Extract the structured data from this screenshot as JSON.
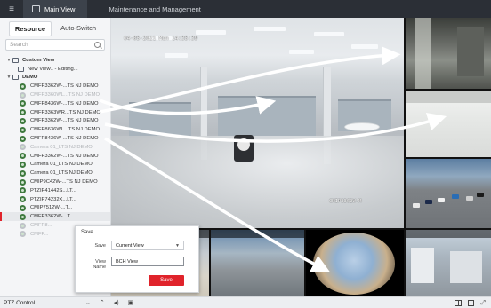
{
  "titlebar": {
    "menu_icon": "menu-icon",
    "tabs": [
      {
        "label": "Main View",
        "active": true
      },
      {
        "label": "Maintenance and Management",
        "active": false
      }
    ]
  },
  "left_panel": {
    "tabs": {
      "resource": "Resource",
      "auto_switch": "Auto-Switch"
    },
    "search_placeholder": "Search",
    "custom_view": {
      "label": "Custom View",
      "items": [
        "New View1 - Editing..."
      ]
    },
    "group": {
      "label": "DEMO"
    },
    "cameras": [
      {
        "name": "CMFP3362W-...TS NJ DEMO",
        "status": "online"
      },
      {
        "name": "CMFP3360WL...TS NJ DEMO",
        "status": "offline"
      },
      {
        "name": "CMFP8436W-...TS NJ DEMO",
        "status": "online"
      },
      {
        "name": "CMFP3363WR...TS NJ DEMO",
        "status": "online"
      },
      {
        "name": "CMFP3362W-...TS NJ DEMO",
        "status": "online"
      },
      {
        "name": "CMFP8636WL...TS NJ DEMO",
        "status": "online"
      },
      {
        "name": "CMFP8436W-...TS NJ DEMO",
        "status": "online"
      },
      {
        "name": "Camera 01_LTS NJ DEMO",
        "status": "offline"
      },
      {
        "name": "CMFP3362W-...TS NJ DEMO",
        "status": "online"
      },
      {
        "name": "Camera 01_LTS NJ DEMO",
        "status": "online"
      },
      {
        "name": "Camera 01_LTS NJ DEMO",
        "status": "online"
      },
      {
        "name": "CMIP9C42W-...TS NJ DEMO",
        "status": "online"
      },
      {
        "name": "PTZIP41442S...LT...",
        "status": "online"
      },
      {
        "name": "PTZIP74232X...LT...",
        "status": "online"
      },
      {
        "name": "CMIP7512W-...T...",
        "status": "online"
      },
      {
        "name": "CMFP3362W-...T...",
        "status": "online",
        "selected": true
      },
      {
        "name": "CMFP8...",
        "status": "offline"
      },
      {
        "name": "CMFP...",
        "status": "offline"
      }
    ]
  },
  "video": {
    "main_osd_date": "04-05-2021 Mon 14:35:39",
    "main_osd_name": "CMIP3362W-M",
    "tile_osd_date": "04-05-2021 Mon 14:35:39"
  },
  "dialog": {
    "title": "Save",
    "save_label": "Save",
    "save_value": "Current View",
    "view_name_label": "View Name",
    "view_name_value": "BCH View",
    "save_button": "Save"
  },
  "bottombar": {
    "ptz_label": "PTZ Control",
    "icons": [
      "chevron-down-icon",
      "chevron-up-icon",
      "audio-icon",
      "save-view-icon"
    ],
    "right_icons": [
      "layout-icon",
      "window-icon",
      "fullscreen-icon"
    ]
  },
  "colors": {
    "titlebar": "#2b2f36",
    "accent_red": "#e0232b",
    "online_green": "#3f7a3f"
  }
}
